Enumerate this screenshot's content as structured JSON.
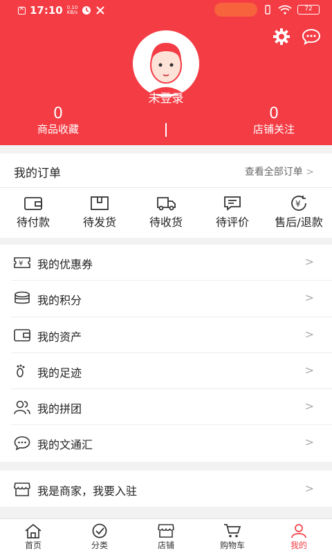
{
  "status_bar": {
    "time": "17:10",
    "speed_value": "0.10",
    "speed_unit": "KB/s",
    "battery": "72"
  },
  "profile": {
    "login_status": "未登录",
    "favorites_count": "0",
    "favorites_label": "商品收藏",
    "follow_count": "0",
    "follow_label": "店铺关注"
  },
  "orders": {
    "title": "我的订单",
    "view_all": "查看全部订单",
    "items": [
      {
        "label": "待付款",
        "icon": "wallet-icon"
      },
      {
        "label": "待发货",
        "icon": "package-icon"
      },
      {
        "label": "待收货",
        "icon": "truck-icon"
      },
      {
        "label": "待评价",
        "icon": "comment-icon"
      },
      {
        "label": "售后/退款",
        "icon": "refund-icon"
      }
    ]
  },
  "menu": [
    {
      "label": "我的优惠券",
      "icon": "coupon-icon"
    },
    {
      "label": "我的积分",
      "icon": "coins-icon"
    },
    {
      "label": "我的资产",
      "icon": "wallet-icon"
    },
    {
      "label": "我的足迹",
      "icon": "footprint-icon"
    },
    {
      "label": "我的拼团",
      "icon": "group-icon"
    },
    {
      "label": "我的文通汇",
      "icon": "chat-icon"
    }
  ],
  "merchant": {
    "label": "我是商家，我要入驻",
    "icon": "shop-icon"
  },
  "tabs": [
    {
      "label": "首页",
      "icon": "home-icon"
    },
    {
      "label": "分类",
      "icon": "check-circle-icon"
    },
    {
      "label": "店铺",
      "icon": "shop-icon"
    },
    {
      "label": "购物车",
      "icon": "cart-icon"
    },
    {
      "label": "我的",
      "icon": "user-icon"
    }
  ],
  "colors": {
    "brand": "#f43c44",
    "background": "#f2f2f2"
  }
}
